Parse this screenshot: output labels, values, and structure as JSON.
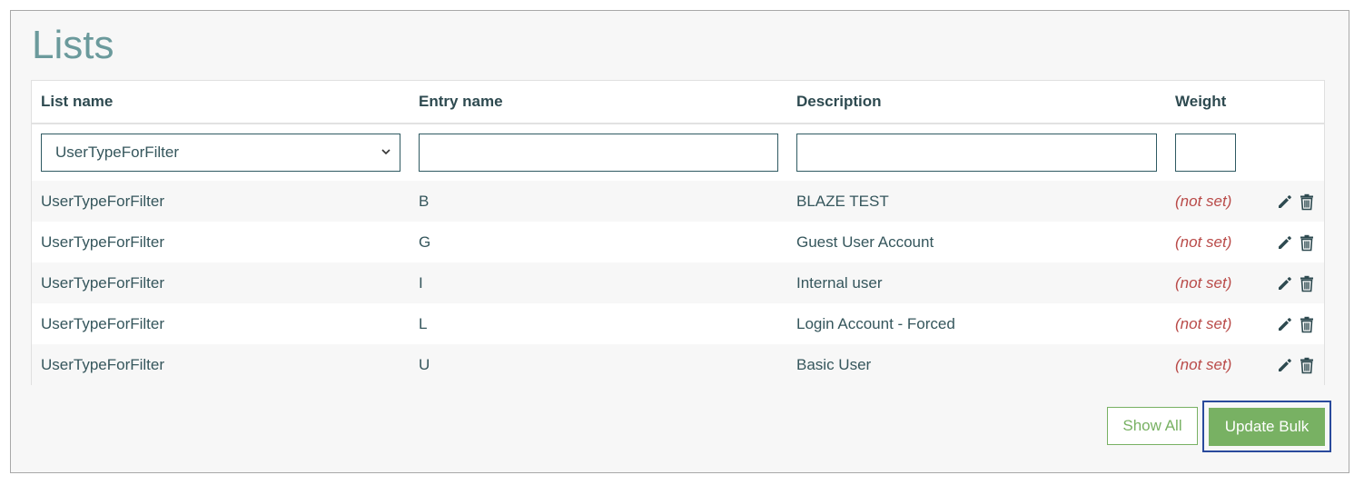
{
  "page": {
    "title": "Lists"
  },
  "table": {
    "headers": {
      "list_name": "List name",
      "entry_name": "Entry name",
      "description": "Description",
      "weight": "Weight"
    },
    "filters": {
      "list_name_selected": "UserTypeForFilter",
      "entry_name_value": "",
      "description_value": "",
      "weight_value": ""
    },
    "rows": [
      {
        "list_name": "UserTypeForFilter",
        "entry_name": "B",
        "description": "BLAZE TEST",
        "weight": "(not set)"
      },
      {
        "list_name": "UserTypeForFilter",
        "entry_name": "G",
        "description": "Guest User Account",
        "weight": "(not set)"
      },
      {
        "list_name": "UserTypeForFilter",
        "entry_name": "I",
        "description": "Internal user",
        "weight": "(not set)"
      },
      {
        "list_name": "UserTypeForFilter",
        "entry_name": "L",
        "description": "Login Account - Forced",
        "weight": "(not set)"
      },
      {
        "list_name": "UserTypeForFilter",
        "entry_name": "U",
        "description": "Basic User",
        "weight": "(not set)"
      }
    ],
    "row_actions": {
      "edit_icon": "pencil-icon",
      "delete_icon": "trash-icon"
    }
  },
  "buttons": {
    "show_all": "Show All",
    "update_bulk": "Update Bulk"
  },
  "colors": {
    "title": "#6b9a9c",
    "text": "#35565c",
    "not_set": "#b94a48",
    "accent_green": "#78b163",
    "focus_border": "#2a4a9c"
  }
}
